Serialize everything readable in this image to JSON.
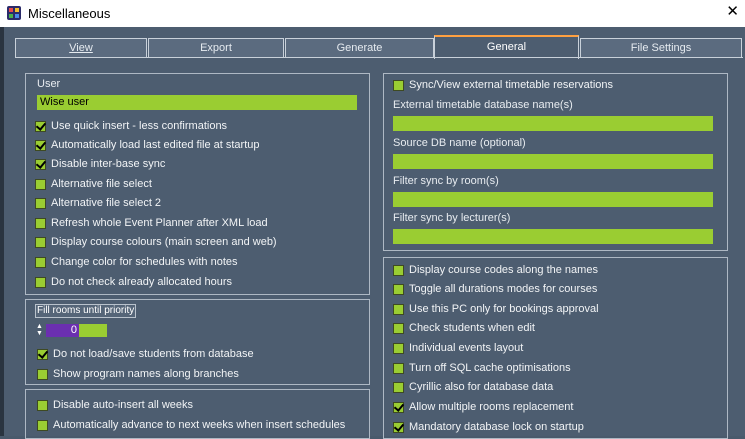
{
  "window": {
    "title": "Miscellaneous",
    "close_glyph": "✕"
  },
  "tabs": [
    {
      "label": "View",
      "active": false
    },
    {
      "label": "Export",
      "active": false
    },
    {
      "label": "Generate",
      "active": false
    },
    {
      "label": "General",
      "active": true
    },
    {
      "label": "File Settings",
      "active": false
    }
  ],
  "user_section": {
    "label": "User",
    "value": "Wise user",
    "options": [
      {
        "label": "Use quick insert - less confirmations",
        "checked": true
      },
      {
        "label": "Automatically load last edited file at startup",
        "checked": true
      },
      {
        "label": "Disable inter-base sync",
        "checked": true
      },
      {
        "label": "Alternative file select",
        "checked": false
      },
      {
        "label": "Alternative file select 2",
        "checked": false
      },
      {
        "label": "Refresh whole Event Planner after XML load",
        "checked": false
      },
      {
        "label": "Display course colours (main screen and web)",
        "checked": false
      },
      {
        "label": "Change color for schedules with notes",
        "checked": false
      },
      {
        "label": "Do not check already allocated hours",
        "checked": false
      }
    ]
  },
  "priority_section": {
    "label": "Fill rooms until priority",
    "value": "0",
    "options": [
      {
        "label": "Do not load/save students from database",
        "checked": true
      },
      {
        "label": "Show program names along branches",
        "checked": false
      }
    ]
  },
  "bottom_left_section": {
    "options": [
      {
        "label": "Disable auto-insert all weeks",
        "checked": false
      },
      {
        "label": "Automatically advance to next weeks when insert schedules",
        "checked": false
      }
    ]
  },
  "sync_section": {
    "toggle": {
      "label": "Sync/View external timetable reservations",
      "checked": false
    },
    "fields": [
      {
        "label": "External timetable database name(s)",
        "value": ""
      },
      {
        "label": "Source DB name (optional)",
        "value": ""
      },
      {
        "label": "Filter sync by room(s)",
        "value": ""
      },
      {
        "label": "Filter sync by lecturer(s)",
        "value": ""
      }
    ]
  },
  "right_options_section": {
    "options": [
      {
        "label": "Display course codes along the names",
        "checked": false
      },
      {
        "label": "Toggle all durations modes for courses",
        "checked": false
      },
      {
        "label": "Use this PC only for bookings approval",
        "checked": false
      },
      {
        "label": "Check students when edit",
        "checked": false
      },
      {
        "label": "Individual events layout",
        "checked": false
      },
      {
        "label": "Turn off SQL cache optimisations",
        "checked": false
      },
      {
        "label": "Cyrillic also for database data",
        "checked": false
      },
      {
        "label": "Allow multiple rooms replacement",
        "checked": true
      },
      {
        "label": "Mandatory database lock on startup",
        "checked": true
      }
    ]
  }
}
